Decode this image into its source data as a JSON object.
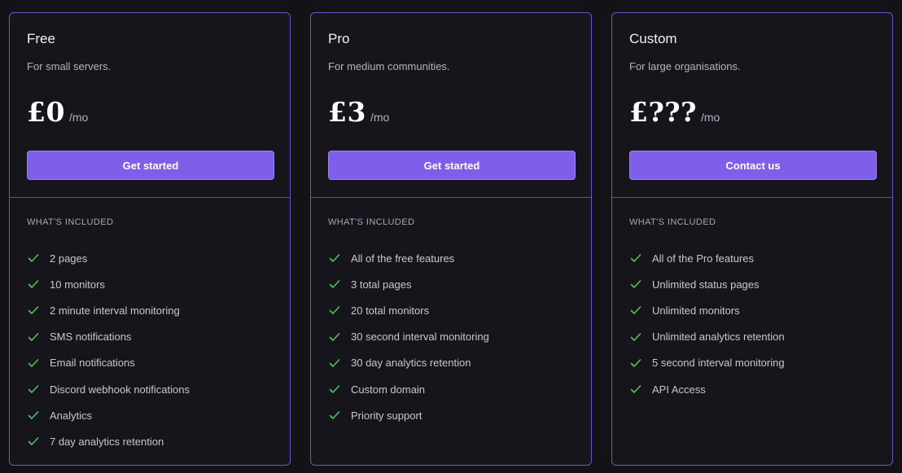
{
  "section": {
    "included_label": "WHAT'S INCLUDED",
    "check_icon": "check-icon",
    "accent_color": "#7f5ee9",
    "check_color": "#4cc45c"
  },
  "plans": [
    {
      "name": "Free",
      "description": "For small servers.",
      "price": "£0",
      "period": "/mo",
      "cta_label": "Get started",
      "features": [
        "2 pages",
        "10 monitors",
        "2 minute interval monitoring",
        "SMS notifications",
        "Email notifications",
        "Discord webhook notifications",
        "Analytics",
        "7 day analytics retention"
      ]
    },
    {
      "name": "Pro",
      "description": "For medium communities.",
      "price": "£3",
      "period": "/mo",
      "cta_label": "Get started",
      "features": [
        "All of the free features",
        "3 total pages",
        "20 total monitors",
        "30 second interval monitoring",
        "30 day analytics retention",
        "Custom domain",
        "Priority support"
      ]
    },
    {
      "name": "Custom",
      "description": "For large organisations.",
      "price": "£???",
      "period": "/mo",
      "cta_label": "Contact us",
      "features": [
        "All of the Pro features",
        "Unlimited status pages",
        "Unlimited monitors",
        "Unlimited analytics retention",
        "5 second interval monitoring",
        "API Access"
      ]
    }
  ]
}
